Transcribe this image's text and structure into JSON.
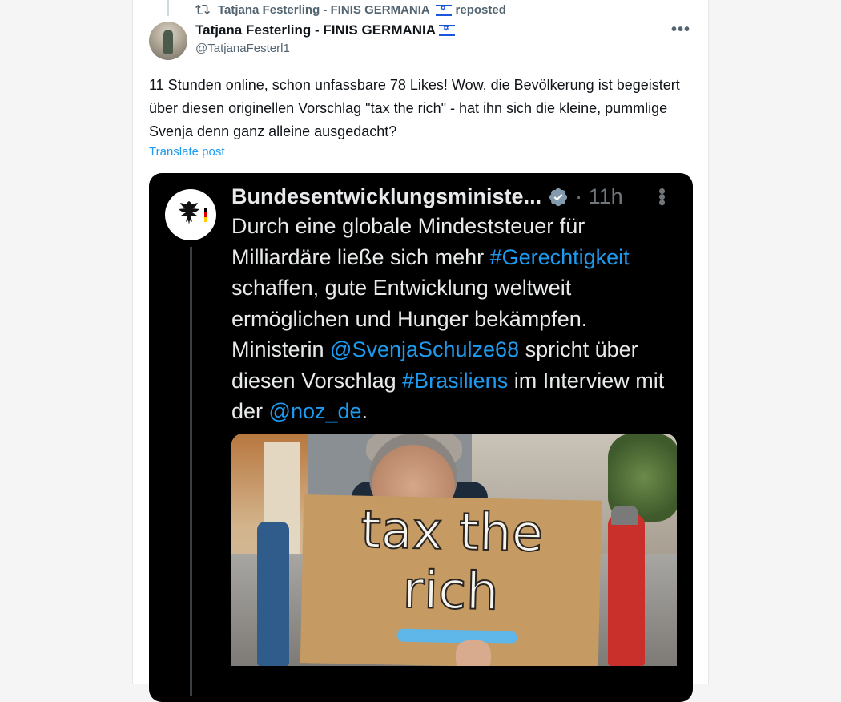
{
  "repost": {
    "label": "Tatjana Festerling - FINIS GERMANIA",
    "suffix": "reposted"
  },
  "author": {
    "name": "Tatjana Festerling - FINIS GERMANIA",
    "handle": "@TatjanaFesterl1"
  },
  "post": {
    "text": "11 Stunden online, schon unfassbare 78 Likes! Wow, die Bevölkerung ist begeistert über diesen originellen Vorschlag \"tax the rich\" - hat ihn sich die kleine, pummlige Svenja denn ganz alleine ausgedacht?",
    "translate_label": "Translate post"
  },
  "embedded": {
    "author": "Bundesentwicklungsministe...",
    "time": "· 11h",
    "text_parts": [
      {
        "t": "Durch eine globale Mindeststeuer für Milliardäre ließe sich mehr ",
        "tag": false
      },
      {
        "t": "#Gerechtigkeit",
        "tag": true
      },
      {
        "t": " schaffen, gute Entwicklung weltweit ermöglichen und Hunger bekämpfen. Ministerin ",
        "tag": false
      },
      {
        "t": "@SvenjaSchulze68",
        "tag": true
      },
      {
        "t": " spricht über diesen Vorschlag ",
        "tag": false
      },
      {
        "t": "#Brasiliens",
        "tag": true
      },
      {
        "t": " im Interview mit der ",
        "tag": false
      },
      {
        "t": "@noz_de",
        "tag": true
      },
      {
        "t": ".",
        "tag": false
      }
    ],
    "sign_line1": "tax the",
    "sign_line2": "rich"
  },
  "icons": {
    "repost": "repost-icon",
    "more": "more-icon",
    "verified": "verified-badge-icon",
    "flag": "israel-flag-icon"
  },
  "colors": {
    "accent": "#1d9bf0",
    "text": "#0f1419",
    "muted": "#536471"
  }
}
